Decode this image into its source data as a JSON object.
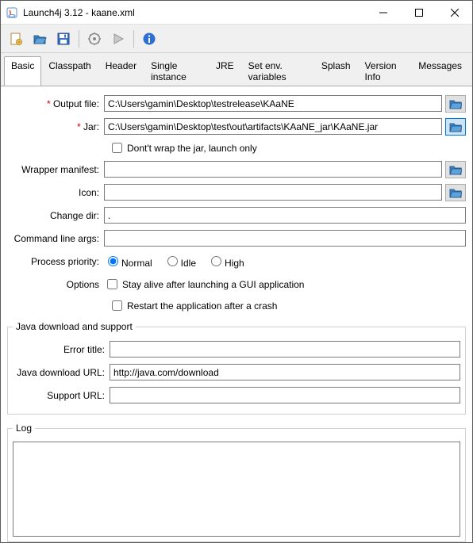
{
  "window": {
    "title": "Launch4j 3.12 - kaane.xml"
  },
  "tabs": {
    "items": [
      "Basic",
      "Classpath",
      "Header",
      "Single instance",
      "JRE",
      "Set env. variables",
      "Splash",
      "Version Info",
      "Messages"
    ],
    "active": 0
  },
  "form": {
    "output_file_label": "Output file:",
    "output_file_value": "C:\\Users\\gamin\\Desktop\\testrelease\\KAaNE",
    "jar_label": "Jar:",
    "jar_value": "C:\\Users\\gamin\\Desktop\\test\\out\\artifacts\\KAaNE_jar\\KAaNE.jar",
    "dont_wrap_label": "Dont't wrap the jar, launch only",
    "wrapper_manifest_label": "Wrapper manifest:",
    "wrapper_manifest_value": "",
    "icon_label": "Icon:",
    "icon_value": "",
    "change_dir_label": "Change dir:",
    "change_dir_value": ".",
    "cmdline_label": "Command line args:",
    "cmdline_value": "",
    "priority_label": "Process priority:",
    "priority_normal": "Normal",
    "priority_idle": "Idle",
    "priority_high": "High",
    "options_label": "Options",
    "stay_alive_label": "Stay alive after launching a GUI application",
    "restart_label": "Restart the application after a crash"
  },
  "java_section": {
    "legend": "Java download and support",
    "error_title_label": "Error title:",
    "error_title_value": "",
    "download_url_label": "Java download URL:",
    "download_url_value": "http://java.com/download",
    "support_url_label": "Support URL:",
    "support_url_value": ""
  },
  "log_section": {
    "legend": "Log"
  }
}
